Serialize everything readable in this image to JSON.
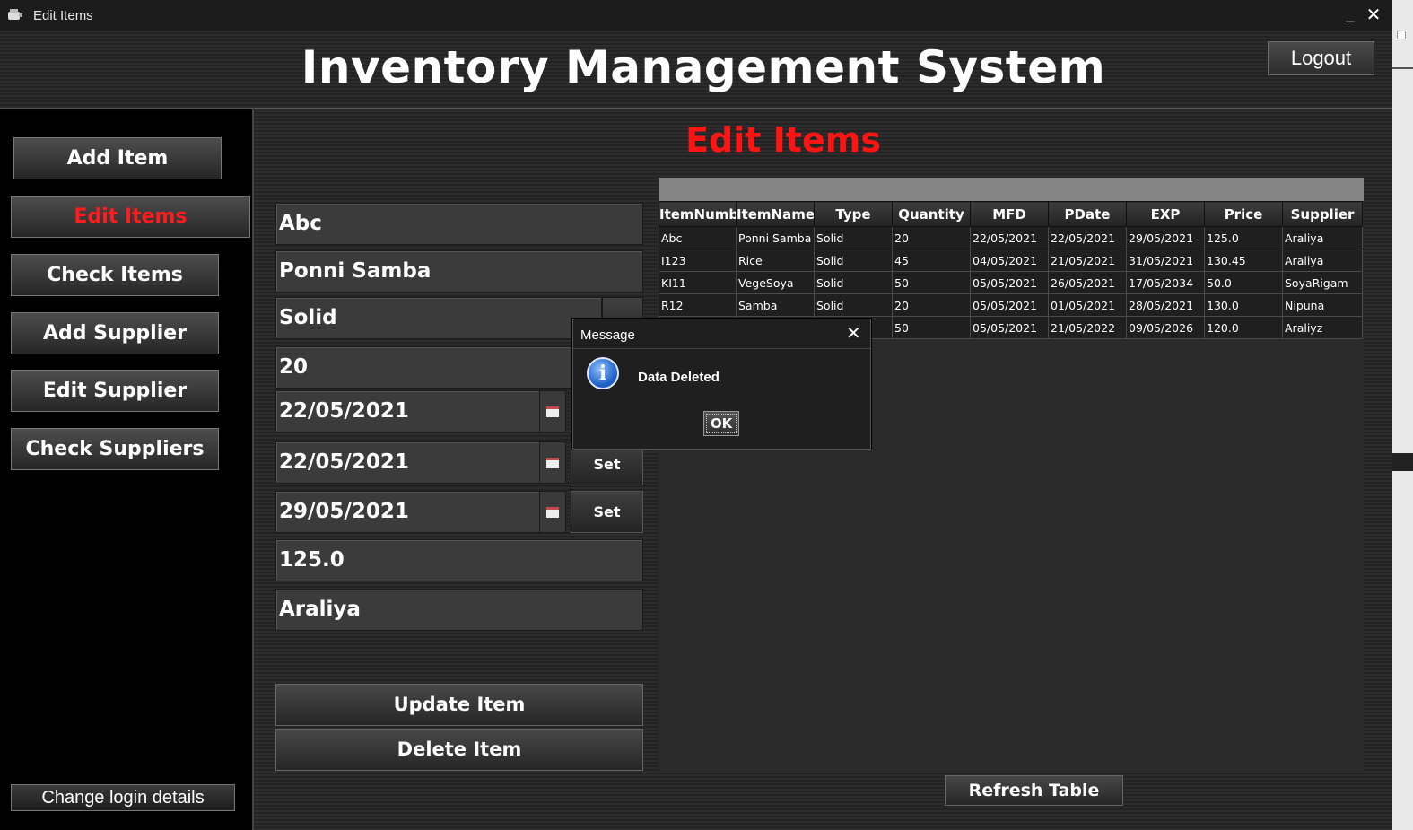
{
  "window": {
    "title": "Edit Items",
    "minimize_glyph": "_",
    "close_glyph": "✕"
  },
  "header": {
    "title": "Inventory Management System",
    "logout_label": "Logout"
  },
  "sidebar": {
    "items": [
      {
        "label": "Add Item",
        "active": false
      },
      {
        "label": "Edit Items",
        "active": true
      },
      {
        "label": "Check Items",
        "active": false
      },
      {
        "label": "Add Supplier",
        "active": false
      },
      {
        "label": "Edit Supplier",
        "active": false
      },
      {
        "label": "Check Suppliers",
        "active": false
      }
    ],
    "change_login_label": "Change login details"
  },
  "main": {
    "section_title": "Edit Items",
    "form": {
      "item_number": "Abc",
      "item_name": "Ponni Samba",
      "type": "Solid",
      "quantity": "20",
      "mfd": "22/05/2021",
      "pdate": "22/05/2021",
      "exp": "29/05/2021",
      "price": "125.0",
      "supplier": "Araliya",
      "set_label": "Set"
    },
    "update_label": "Update Item",
    "delete_label": "Delete Item",
    "refresh_label": "Refresh Table"
  },
  "table": {
    "columns": [
      "ItemNumb...",
      "ItemName",
      "Type",
      "Quantity",
      "MFD",
      "PDate",
      "EXP",
      "Price",
      "Supplier"
    ],
    "rows": [
      [
        "Abc",
        "Ponni Samba",
        "Solid",
        "20",
        "22/05/2021",
        "22/05/2021",
        "29/05/2021",
        "125.0",
        "Araliya"
      ],
      [
        "I123",
        "Rice",
        "Solid",
        "45",
        "04/05/2021",
        "21/05/2021",
        "31/05/2021",
        "130.45",
        "Araliya"
      ],
      [
        "KI11",
        "VegeSoya",
        "Solid",
        "50",
        "05/05/2021",
        "26/05/2021",
        "17/05/2034",
        "50.0",
        "SoyaRigam"
      ],
      [
        "R12",
        "Samba",
        "Solid",
        "20",
        "05/05/2021",
        "01/05/2021",
        "28/05/2021",
        "130.0",
        "Nipuna"
      ],
      [
        "",
        "",
        "",
        "50",
        "05/05/2021",
        "21/05/2022",
        "09/05/2026",
        "120.0",
        "Araliyz"
      ]
    ]
  },
  "dialog": {
    "title": "Message",
    "message": "Data Deleted",
    "ok_label": "OK",
    "icon_glyph": "i"
  },
  "colors": {
    "accent_red": "#ff1414",
    "background": "#2a2a2a",
    "sidebar": "#000000"
  }
}
